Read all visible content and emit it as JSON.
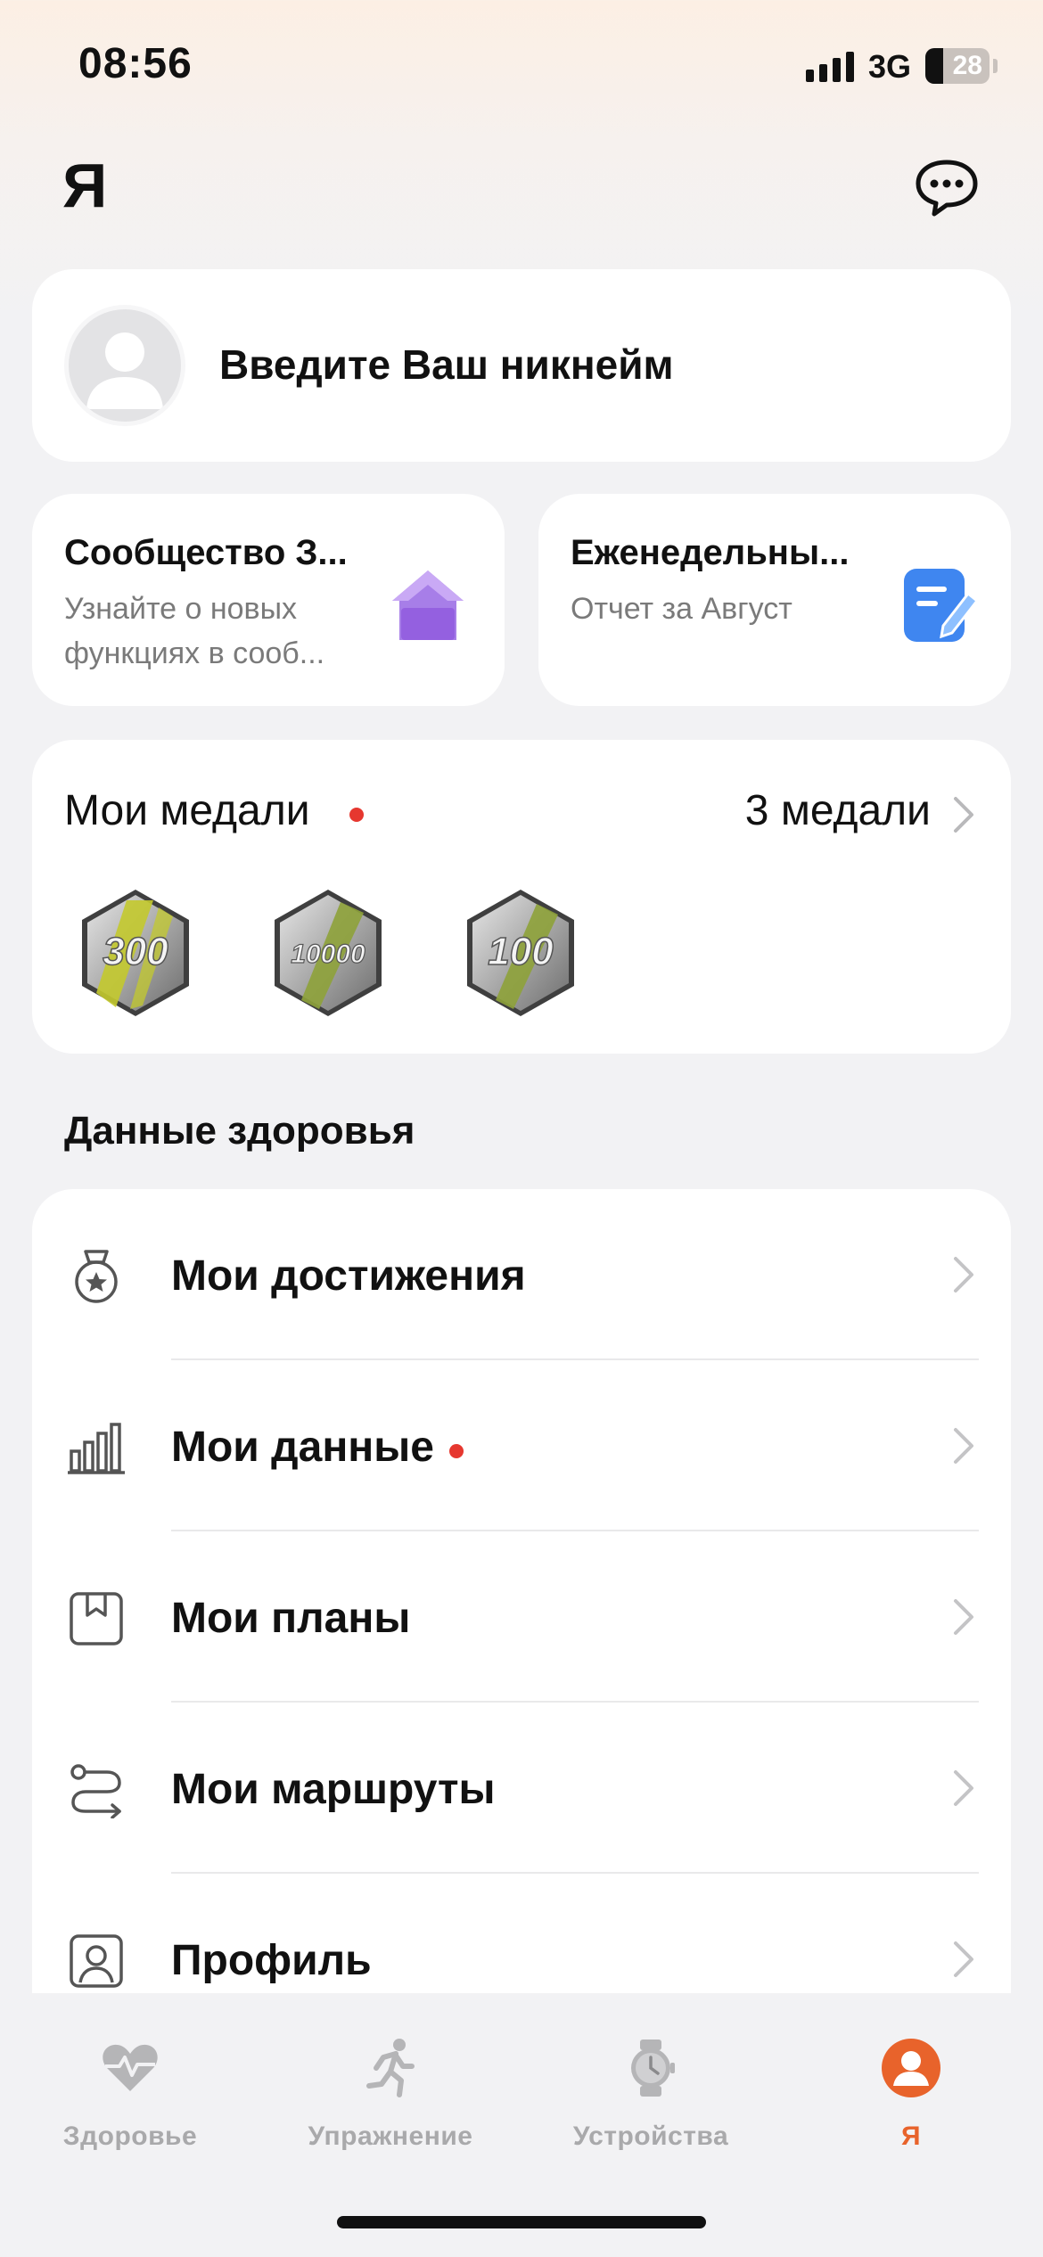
{
  "status_bar": {
    "time": "08:56",
    "network": "3G",
    "battery": "28"
  },
  "header": {
    "title": "Я",
    "chat_icon": "chat-bubble-icon"
  },
  "profile": {
    "nickname_placeholder": "Введите Ваш никнейм",
    "avatar_icon": "avatar-placeholder-icon"
  },
  "cards": [
    {
      "title": "Сообщество З...",
      "subtitle": "Узнайте о новых функциях в сооб...",
      "icon": "house-icon",
      "accent": "#a77ee8"
    },
    {
      "title": "Еженедельны...",
      "subtitle": "Отчет за Август",
      "icon": "note-edit-icon",
      "accent": "#3f86f0"
    }
  ],
  "medals": {
    "title": "Мои медали",
    "count_label": "3 медали",
    "items": [
      {
        "label": "300",
        "stripe": "#c3c92e"
      },
      {
        "label": "10000",
        "stripe": "#8ea23a"
      },
      {
        "label": "100",
        "stripe": "#8ea23a"
      }
    ]
  },
  "health": {
    "section_title": "Данные здоровья",
    "items": [
      {
        "label": "Мои достижения",
        "icon": "medal-star-icon",
        "badge": false
      },
      {
        "label": "Мои данные",
        "icon": "bar-chart-icon",
        "badge": true
      },
      {
        "label": "Мои планы",
        "icon": "plan-bookmark-icon",
        "badge": false
      },
      {
        "label": "Мои маршруты",
        "icon": "route-icon",
        "badge": false
      },
      {
        "label": "Профиль",
        "icon": "profile-card-icon",
        "badge": false
      }
    ]
  },
  "tabs": [
    {
      "label": "Здоровье",
      "icon": "heart-pulse-icon",
      "active": false
    },
    {
      "label": "Упражнение",
      "icon": "running-icon",
      "active": false
    },
    {
      "label": "Устройства",
      "icon": "watch-icon",
      "active": false
    },
    {
      "label": "Я",
      "icon": "user-circle-icon",
      "active": true
    }
  ],
  "colors": {
    "accent": "#e8632b",
    "badge": "#e6372f",
    "inactive_tab": "#a9a9ab"
  }
}
